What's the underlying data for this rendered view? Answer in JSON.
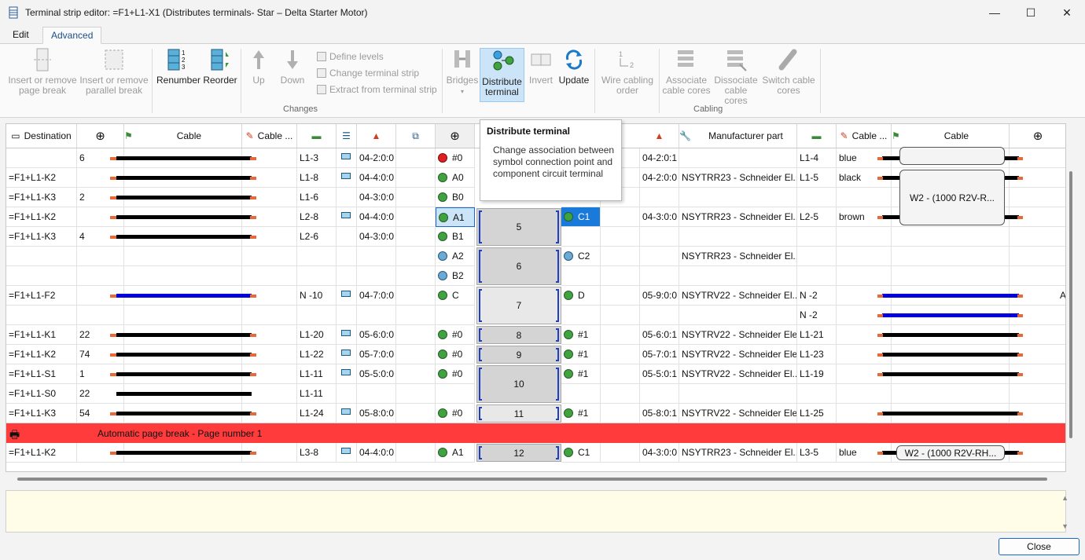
{
  "window": {
    "title": "Terminal strip editor: =F1+L1-X1 (Distributes terminals- Star – Delta Starter Motor)",
    "minimize_glyph": "—",
    "maximize_glyph": "☐",
    "close_glyph": "✕"
  },
  "tabs": [
    {
      "label": "Edit",
      "active": false
    },
    {
      "label": "Advanced",
      "active": true
    }
  ],
  "ribbon": {
    "insert_page_break": "Insert or remove page break",
    "insert_parallel_break": "Insert or remove parallel break",
    "renumber": "Renumber",
    "reorder": "Reorder",
    "up": "Up",
    "down": "Down",
    "define_levels": "Define levels",
    "change_terminal_strip": "Change terminal strip",
    "extract_from_terminal_strip": "Extract from terminal strip",
    "bridges": "Bridges",
    "distribute_terminal": "Distribute terminal",
    "invert": "Invert",
    "update": "Update",
    "wire_cabling_order": "Wire cabling order",
    "associate_cable_cores": "Associate cable cores",
    "dissociate_cable_cores": "Dissociate cable cores",
    "switch_cable_cores": "Switch cable cores",
    "group_changes": "Changes",
    "group_cabling": "Cabling"
  },
  "tooltip": {
    "title": "Distribute terminal",
    "body": "Change association between symbol connection point and component circuit terminal"
  },
  "columns": {
    "destination": "Destination",
    "cable": "Cable",
    "cable_short": "Cable ...",
    "manufacturer_part": "Manufacturer part",
    "cable_right": "Cable",
    "cable_short_right": "Cable ..."
  },
  "rows": [
    {
      "dest": "",
      "num": "6",
      "wire": "L1-3",
      "ref": "04-2:0:0",
      "pt": "#0",
      "ptdot": "red",
      "rpt": "",
      "rref": "04-2:0:1",
      "mfr": "",
      "rwire": "L1-4",
      "color": "blue"
    },
    {
      "dest": "=F1+L1-K2",
      "num": "",
      "wire": "L1-8",
      "ref": "04-4:0:0",
      "pt": "A0",
      "ptdot": "green",
      "rpt": "",
      "rref": "04-2:0:0",
      "mfr": "NSYTRR23 - Schneider El...",
      "rwire": "L1-5",
      "color": "black"
    },
    {
      "dest": "=F1+L1-K3",
      "num": "2",
      "wire": "L1-6",
      "ref": "04-3:0:0",
      "pt": "B0",
      "ptdot": "green",
      "rpt": "",
      "rref": "",
      "mfr": "",
      "rwire": "",
      "color": ""
    },
    {
      "dest": "=F1+L1-K2",
      "num": "",
      "wire": "L2-8",
      "ref": "04-4:0:0",
      "pt": "A1",
      "ptdot": "green",
      "rpt": "C1",
      "rref": "04-3:0:0",
      "mfr": "NSYTRR23 - Schneider El...",
      "rwire": "L2-5",
      "color": "brown"
    },
    {
      "dest": "=F1+L1-K3",
      "num": "4",
      "wire": "L2-6",
      "ref": "04-3:0:0",
      "pt": "B1",
      "ptdot": "green",
      "rpt": "",
      "rref": "",
      "mfr": "",
      "rwire": "",
      "color": ""
    },
    {
      "dest": "",
      "num": "",
      "wire": "",
      "ref": "",
      "pt": "A2",
      "ptdot": "blue",
      "rpt": "C2",
      "rref": "",
      "mfr": "NSYTRR23 - Schneider El...",
      "rwire": "",
      "color": ""
    },
    {
      "dest": "",
      "num": "",
      "wire": "",
      "ref": "",
      "pt": "B2",
      "ptdot": "blue",
      "rpt": "",
      "rref": "",
      "mfr": "",
      "rwire": "",
      "color": ""
    },
    {
      "dest": "=F1+L1-F2",
      "num": "",
      "wire": "N -10",
      "ref": "04-7:0:0",
      "pt": "C",
      "ptdot": "green",
      "rpt": "D",
      "rref": "05-9:0:0",
      "mfr": "NSYTRV22 - Schneider El...",
      "rwire": "N -2",
      "color": ""
    },
    {
      "dest": "",
      "num": "",
      "wire": "",
      "ref": "",
      "pt": "",
      "ptdot": "",
      "rpt": "",
      "rref": "",
      "mfr": "",
      "rwire": "N -2",
      "color": ""
    },
    {
      "dest": "=F1+L1-K1",
      "num": "22",
      "wire": "L1-20",
      "ref": "05-6:0:0",
      "pt": "#0",
      "ptdot": "green",
      "rpt": "#1",
      "rref": "05-6:0:1",
      "mfr": "NSYTRV22 - Schneider Ele...",
      "rwire": "L1-21",
      "color": ""
    },
    {
      "dest": "=F1+L1-K2",
      "num": "74",
      "wire": "L1-22",
      "ref": "05-7:0:0",
      "pt": "#0",
      "ptdot": "green",
      "rpt": "#1",
      "rref": "05-7:0:1",
      "mfr": "NSYTRV22 - Schneider Ele...",
      "rwire": "L1-23",
      "color": ""
    },
    {
      "dest": "=F1+L1-S1",
      "num": "1",
      "wire": "L1-11",
      "ref": "05-5:0:0",
      "pt": "#0",
      "ptdot": "green",
      "rpt": "#1",
      "rref": "05-5:0:1",
      "mfr": "NSYTRV22 - Schneider El...",
      "rwire": "L1-19",
      "color": ""
    },
    {
      "dest": "=F1+L1-S0",
      "num": "22",
      "wire": "L1-11",
      "ref": "",
      "pt": "",
      "ptdot": "",
      "rpt": "",
      "rref": "",
      "mfr": "",
      "rwire": "",
      "color": ""
    },
    {
      "dest": "=F1+L1-K3",
      "num": "54",
      "wire": "L1-24",
      "ref": "05-8:0:0",
      "pt": "#0",
      "ptdot": "green",
      "rpt": "#1",
      "rref": "05-8:0:1",
      "mfr": "NSYTRV22 - Schneider Ele...",
      "rwire": "L1-25",
      "color": ""
    },
    {
      "dest": "=F1+L1-K2",
      "num": "",
      "wire": "L3-8",
      "ref": "04-4:0:0",
      "pt": "A1",
      "ptdot": "green",
      "rpt": "C1",
      "rref": "04-3:0:0",
      "mfr": "NSYTRR23 - Schneider El...",
      "rwire": "L3-5",
      "color": "blue"
    }
  ],
  "terminals": [
    "5",
    "6",
    "7",
    "8",
    "9",
    "10",
    "11",
    "12"
  ],
  "page_break": "Automatic page break - Page number 1",
  "cable_labels": {
    "w2_top": "W2 - (1000 R2V-R...",
    "w2_bottom": "W2 - (1000 R2V-RH..."
  },
  "overflow_text": "A",
  "close_button": "Close",
  "colors": {
    "accent": "#1a66c9",
    "selection": "#cce4f7",
    "page_break": "#ff3b3b",
    "wire_blue": "#0000dd",
    "wire_black": "#000000",
    "wire_end": "#e8683a",
    "notes_bg": "#fffde7"
  }
}
